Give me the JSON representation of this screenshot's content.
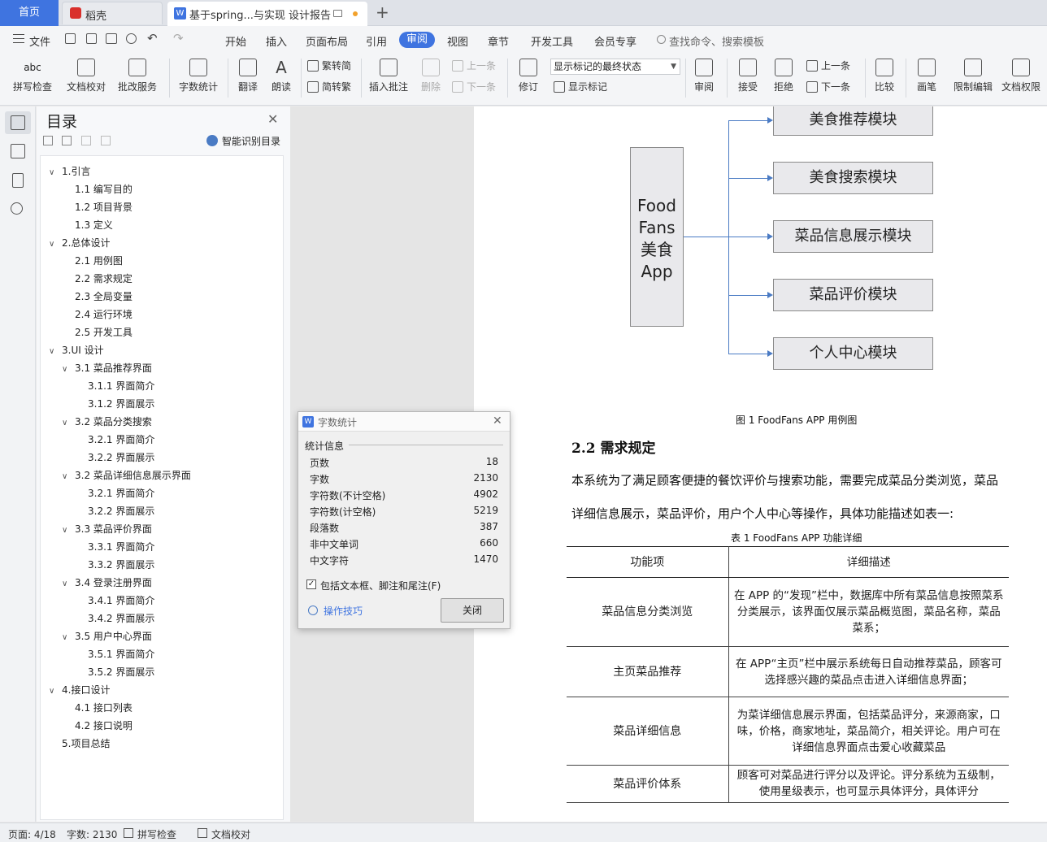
{
  "tabs": {
    "home": "首页",
    "daoke": "稻壳",
    "doc": "基于spring...与实现 设计报告",
    "new_tab": "+"
  },
  "menu": {
    "file": "文件",
    "items": [
      "开始",
      "插入",
      "页面布局",
      "引用",
      "审阅",
      "视图",
      "章节",
      "开发工具",
      "会员专享"
    ],
    "search": "查找命令、搜索模板"
  },
  "ribbon": {
    "spellcheck": "拼写检查",
    "doccheck": "文档校对",
    "batch": "批改服务",
    "wordcount": "字数统计",
    "translate": "翻译",
    "read": "朗读",
    "t2s": "繁转简",
    "s2t": "简转繁",
    "insert_comment": "插入批注",
    "delete": "删除",
    "prev": "上一条",
    "next": "下一条",
    "revise": "修订",
    "markup_select": "显示标记的最终状态",
    "show_markup": "显示标记",
    "review": "审阅",
    "accept": "接受",
    "reject": "拒绝",
    "prev2": "上一条",
    "next2": "下一条",
    "compare": "比较",
    "pen": "画笔",
    "restrict": "限制编辑",
    "perm": "文档权限"
  },
  "toc": {
    "title": "目录",
    "smart": "智能识别目录",
    "items": [
      {
        "text": "1.引言",
        "level": 1,
        "arrow": true
      },
      {
        "text": "1.1 编写目的",
        "level": 2,
        "arrow": false
      },
      {
        "text": "1.2 项目背景",
        "level": 2,
        "arrow": false
      },
      {
        "text": "1.3 定义",
        "level": 2,
        "arrow": false
      },
      {
        "text": "2.总体设计",
        "level": 1,
        "arrow": true
      },
      {
        "text": "2.1 用例图",
        "level": 2,
        "arrow": false
      },
      {
        "text": "2.2 需求规定",
        "level": 2,
        "arrow": false
      },
      {
        "text": "2.3 全局变量",
        "level": 2,
        "arrow": false
      },
      {
        "text": "2.4 运行环境",
        "level": 2,
        "arrow": false
      },
      {
        "text": "2.5 开发工具",
        "level": 2,
        "arrow": false
      },
      {
        "text": "3.UI 设计",
        "level": 1,
        "arrow": true
      },
      {
        "text": "3.1 菜品推荐界面",
        "level": 2,
        "arrow": true
      },
      {
        "text": "3.1.1 界面简介",
        "level": 3,
        "arrow": false
      },
      {
        "text": "3.1.2 界面展示",
        "level": 3,
        "arrow": false
      },
      {
        "text": "3.2 菜品分类搜索",
        "level": 2,
        "arrow": true
      },
      {
        "text": "3.2.1 界面简介",
        "level": 3,
        "arrow": false
      },
      {
        "text": "3.2.2 界面展示",
        "level": 3,
        "arrow": false
      },
      {
        "text": "3.2 菜品详细信息展示界面",
        "level": 2,
        "arrow": true
      },
      {
        "text": "3.2.1 界面简介",
        "level": 3,
        "arrow": false
      },
      {
        "text": "3.2.2 界面展示",
        "level": 3,
        "arrow": false
      },
      {
        "text": "3.3 菜品评价界面",
        "level": 2,
        "arrow": true
      },
      {
        "text": "3.3.1 界面简介",
        "level": 3,
        "arrow": false
      },
      {
        "text": "3.3.2 界面展示",
        "level": 3,
        "arrow": false
      },
      {
        "text": "3.4 登录注册界面",
        "level": 2,
        "arrow": true
      },
      {
        "text": "3.4.1 界面简介",
        "level": 3,
        "arrow": false
      },
      {
        "text": "3.4.2 界面展示",
        "level": 3,
        "arrow": false
      },
      {
        "text": "3.5 用户中心界面",
        "level": 2,
        "arrow": true
      },
      {
        "text": "3.5.1 界面简介",
        "level": 3,
        "arrow": false
      },
      {
        "text": "3.5.2 界面展示",
        "level": 3,
        "arrow": false
      },
      {
        "text": "4.接口设计",
        "level": 1,
        "arrow": true
      },
      {
        "text": "4.1 接口列表",
        "level": 2,
        "arrow": false
      },
      {
        "text": "4.2 接口说明",
        "level": 2,
        "arrow": false
      },
      {
        "text": "5.项目总结",
        "level": 1,
        "arrow": false
      }
    ]
  },
  "diagram": {
    "app_lines": [
      "Food",
      "Fans",
      "美食",
      "App"
    ],
    "modules": [
      "美食推荐模块",
      "美食搜索模块",
      "菜品信息展示模块",
      "菜品评价模块",
      "个人中心模块"
    ],
    "caption": "图 1 FoodFans APP 用例图"
  },
  "doc": {
    "heading": "2.2 需求规定",
    "para1": "本系统为了满足顾客便捷的餐饮评价与搜索功能，需要完成菜品分类浏览，菜品",
    "para2": "详细信息展示，菜品评价，用户个人中心等操作，具体功能描述如表一:",
    "table_caption": "表 1 FoodFans APP 功能详细",
    "table_head": [
      "功能项",
      "详细描述"
    ],
    "table_rows": [
      {
        "name": "菜品信息分类浏览",
        "desc": "在 APP 的“发现”栏中，数据库中所有菜品信息按照菜系分类展示，该界面仅展示菜品概览图，菜品名称，菜品菜系；"
      },
      {
        "name": "主页菜品推荐",
        "desc": "在 APP“主页”栏中展示系统每日自动推荐菜品，顾客可选择感兴趣的菜品点击进入详细信息界面；"
      },
      {
        "name": "菜品详细信息",
        "desc": "为菜详细信息展示界面，包括菜品评分，来源商家，口味，价格，商家地址，菜品简介，相关评论。用户可在详细信息界面点击爱心收藏菜品"
      },
      {
        "name": "菜品评价体系",
        "desc": "顾客可对菜品进行评分以及评论。评分系统为五级制，使用星级表示，也可显示具体评分，具体评分"
      }
    ]
  },
  "dialog": {
    "title": "字数统计",
    "section": "统计信息",
    "rows": [
      {
        "label": "页数",
        "value": "18"
      },
      {
        "label": "字数",
        "value": "2130"
      },
      {
        "label": "字符数(不计空格)",
        "value": "4902"
      },
      {
        "label": "字符数(计空格)",
        "value": "5219"
      },
      {
        "label": "段落数",
        "value": "387"
      },
      {
        "label": "非中文单词",
        "value": "660"
      },
      {
        "label": "中文字符",
        "value": "1470"
      }
    ],
    "checkbox": "包括文本框、脚注和尾注(F)",
    "tips": "操作技巧",
    "close": "关闭"
  },
  "status": {
    "page": "页面: 4/18",
    "words": "字数: 2130",
    "spell": "拼写检查",
    "doccheck": "文档校对"
  },
  "colors": {
    "accent": "#3f74e0",
    "arrow": "#4a7bc4"
  }
}
